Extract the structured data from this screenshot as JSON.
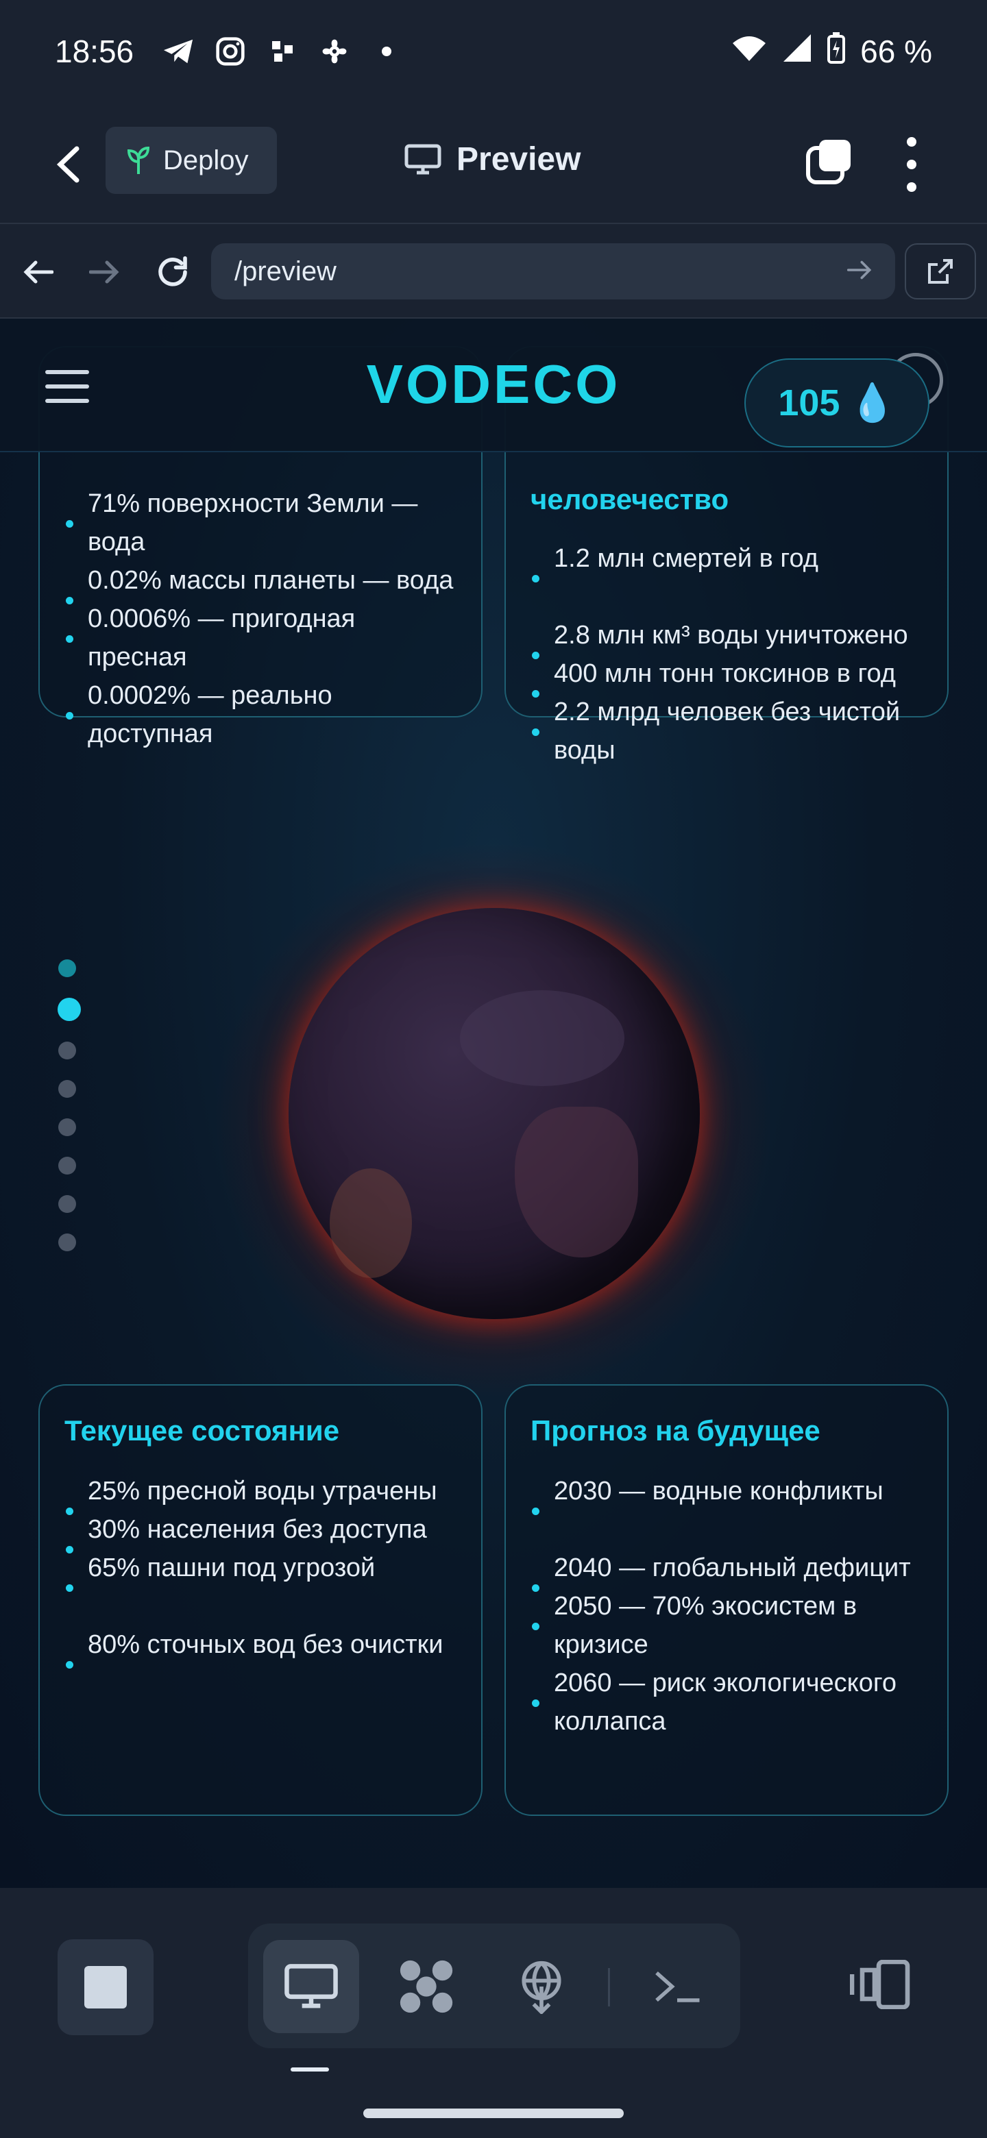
{
  "status_bar": {
    "time": "18:56",
    "battery": "66 %"
  },
  "app_bar": {
    "deploy_label": "Deploy",
    "title": "Preview"
  },
  "url_bar": {
    "url": "/preview"
  },
  "site": {
    "logo": "VODECO",
    "drops_count": "105",
    "drop_emoji": "💧",
    "card_top_left": {
      "items": [
        "71% поверхности Земли — вода",
        "0.02% массы планеты — вода",
        "0.0006% — пригодная пресная",
        "0.0002% — реально доступная"
      ]
    },
    "card_top_right": {
      "title": "человечество",
      "items": [
        "1.2 млн смертей в год",
        "2.8 млн км³ воды уничтожено",
        "400 млн тонн токсинов в год",
        "2.2 млрд человек без чистой воды"
      ]
    },
    "card_current": {
      "title": "Текущее состояние",
      "items": [
        "25% пресной воды утрачены",
        "30% населения без доступа",
        "65% пашни под угрозой",
        "80% сточных вод без очистки"
      ]
    },
    "card_forecast": {
      "title": "Прогноз на будущее",
      "items": [
        "2030 — водные конфликты",
        "2040 — глобальный дефицит",
        "2050 — 70% экосистем в кризисе",
        "2060 — риск экологического коллапса"
      ]
    },
    "pager": {
      "total": 8,
      "active_index": 1
    }
  },
  "colors": {
    "accent": "#22d3ee",
    "bg": "#0b1220",
    "chrome": "#1a2230",
    "glow": "#dc2814"
  },
  "icons": [
    "telegram-icon",
    "instagram-icon",
    "app-icon",
    "pinwheel-icon",
    "wifi-icon",
    "signal-icon",
    "battery-icon",
    "back-icon",
    "sprout-icon",
    "monitor-icon",
    "tabs-icon",
    "more-icon",
    "arrow-left-icon",
    "arrow-right-icon",
    "reload-icon",
    "open-external-icon",
    "menu-icon",
    "user-icon",
    "stop-icon",
    "grid-icon",
    "deploy-icon",
    "terminal-icon",
    "devices-icon"
  ]
}
